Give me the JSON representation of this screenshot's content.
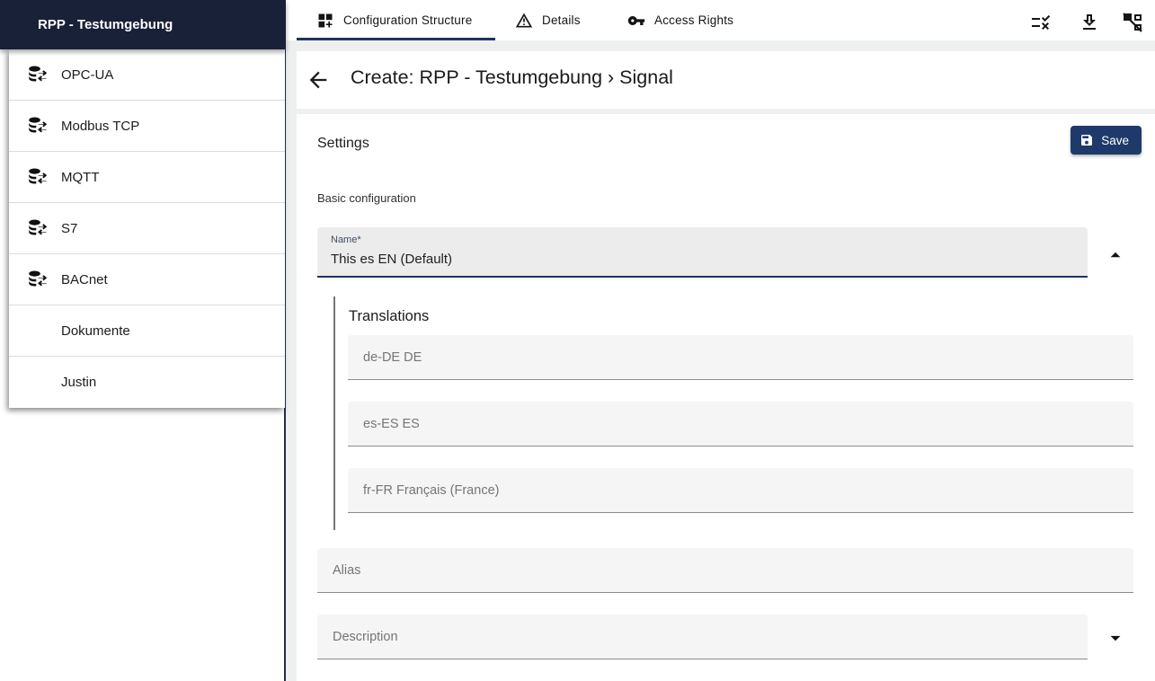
{
  "sidebar": {
    "header_title": "RPP - Testumgebung",
    "items": [
      {
        "label": "OPC-UA",
        "has_icon": true
      },
      {
        "label": "Modbus TCP",
        "has_icon": true
      },
      {
        "label": "MQTT",
        "has_icon": true
      },
      {
        "label": "S7",
        "has_icon": true
      },
      {
        "label": "BACnet",
        "has_icon": true
      },
      {
        "label": "Dokumente",
        "has_icon": false
      },
      {
        "label": "Justin",
        "has_icon": false
      }
    ]
  },
  "tabbar": {
    "tabs": [
      {
        "label": "Configuration Structure",
        "icon": "dashboard-customize-icon",
        "active": true
      },
      {
        "label": "Details",
        "icon": "warning-icon",
        "active": false
      },
      {
        "label": "Access Rights",
        "icon": "key-icon",
        "active": false
      }
    ],
    "action_icons": [
      "rule-icon",
      "download-icon",
      "tree-structure-icon"
    ]
  },
  "header": {
    "title": "Create: RPP - Testumgebung › Signal"
  },
  "settings": {
    "section_title": "Settings",
    "save_label": "Save",
    "group_label": "Basic configuration",
    "name_field": {
      "label": "Name*",
      "value": "This es EN (Default)"
    },
    "translations": {
      "title": "Translations",
      "fields": [
        {
          "placeholder": "de-DE DE",
          "value": ""
        },
        {
          "placeholder": "es-ES ES",
          "value": ""
        },
        {
          "placeholder": "fr-FR Français (France)",
          "value": ""
        }
      ]
    },
    "alias_field": {
      "placeholder": "Alias",
      "value": ""
    },
    "description_field": {
      "placeholder": "Description",
      "value": ""
    }
  },
  "colors": {
    "accent_navy": "#1d3461",
    "sidebar_header_bg": "#192138",
    "save_button_bg": "#1e3a6a",
    "page_bg": "#eef0f0",
    "field_bg": "#f5f5f5",
    "name_field_bg": "#ececec"
  }
}
